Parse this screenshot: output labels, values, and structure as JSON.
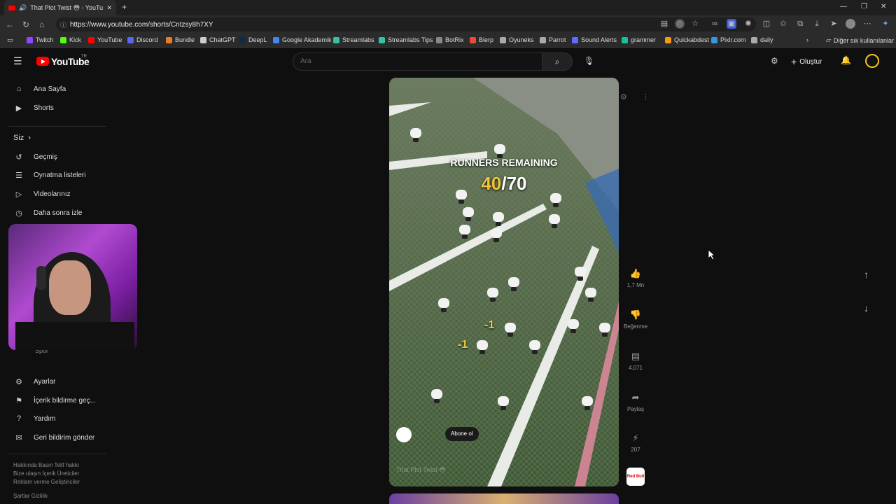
{
  "browser": {
    "tab_title": "That Plot Twist 😳 - YouTube",
    "url": "https://www.youtube.com/shorts/Cntzsy8h7XY",
    "bookmarks": [
      {
        "label": "Twitch",
        "color": "#9146ff"
      },
      {
        "label": "Kick",
        "color": "#53fc18"
      },
      {
        "label": "YouTube",
        "color": "#ff0000"
      },
      {
        "label": "Discord",
        "color": "#5865f2"
      },
      {
        "label": "Bundle",
        "color": "#e67e22"
      },
      {
        "label": "ChatGPT",
        "color": "#cccccc"
      },
      {
        "label": "DeepL",
        "color": "#0f2b46"
      },
      {
        "label": "Google Akademik",
        "color": "#4285f4"
      },
      {
        "label": "Streamlabs",
        "color": "#31c3a2"
      },
      {
        "label": "Streamlabs Tips",
        "color": "#31c3a2"
      },
      {
        "label": "BotRix",
        "color": "#888888"
      },
      {
        "label": "Bierp",
        "color": "#e74c3c"
      },
      {
        "label": "Oyuneks",
        "color": "#aaaaaa"
      },
      {
        "label": "Parrot",
        "color": "#aaaaaa"
      },
      {
        "label": "Sound Alerts",
        "color": "#5b6cff"
      },
      {
        "label": "grammer",
        "color": "#15c39a"
      },
      {
        "label": "Quickabdest",
        "color": "#f39c12"
      },
      {
        "label": "Pixlr.com",
        "color": "#3498db"
      },
      {
        "label": "daily",
        "color": "#aaaaaa"
      }
    ],
    "other_bookmarks": "Diğer sık kullanılanlar"
  },
  "header": {
    "logo": "YouTube",
    "logo_region": "TR",
    "search_placeholder": "Ara",
    "create_label": "Oluştur"
  },
  "sidebar": {
    "main": [
      {
        "label": "Ana Sayfa",
        "icon": "home-icon"
      },
      {
        "label": "Shorts",
        "icon": "shorts-icon"
      }
    ],
    "you_label": "Siz",
    "you_items": [
      {
        "label": "Geçmiş",
        "icon": "history-icon"
      },
      {
        "label": "Oynatma listeleri",
        "icon": "playlist-icon"
      },
      {
        "label": "Videolarınız",
        "icon": "your-videos-icon"
      },
      {
        "label": "Daha sonra izle",
        "icon": "watch-later-icon"
      }
    ],
    "hidden_item": "Spor",
    "settings_items": [
      {
        "label": "Ayarlar",
        "icon": "settings-icon"
      },
      {
        "label": "İçerik bildirme geç...",
        "icon": "flag-icon"
      },
      {
        "label": "Yardım",
        "icon": "help-icon"
      },
      {
        "label": "Geri bildirim gönder",
        "icon": "feedback-icon"
      }
    ],
    "footer_lines": [
      "Hakkında  Basın  Telif hakkı",
      "Bize ulaşın  İçerik Üreticiler",
      "Reklam verme  Geliştiriciler",
      "Şartlar  Gizlilik"
    ]
  },
  "video": {
    "overlay_title": "RUNNERS REMAINING",
    "count_current": "40",
    "count_total": "/70",
    "minus_one": "-1",
    "subscribe_label": "Abone ol",
    "caption": "That Plot Twist 😳"
  },
  "actions": {
    "likes": "1,7 Mn",
    "dislike_label": "Beğenme",
    "comments": "4.071",
    "share_label": "Paylaş",
    "remix": "207",
    "channel_badge": "Red Bull"
  },
  "colors": {
    "accent": "#ff0000",
    "count_gold": "#f0c23a",
    "background": "#0f0f0f"
  }
}
